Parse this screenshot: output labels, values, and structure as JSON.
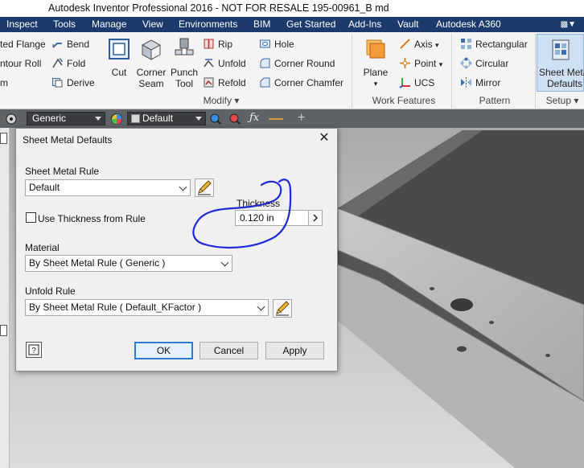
{
  "window": {
    "title": "Autodesk Inventor Professional 2016 - NOT FOR RESALE    195-00961_B md"
  },
  "menu": {
    "tabs": [
      "Inspect",
      "Tools",
      "Manage",
      "View",
      "Environments",
      "BIM",
      "Get Started",
      "Add-Ins",
      "Vault",
      "Autodesk A360"
    ]
  },
  "ribbon": {
    "left_items": [
      "ted Flange",
      "ntour Roll",
      "m"
    ],
    "bend_items": [
      "Bend",
      "Fold",
      "Derive"
    ],
    "big_buttons": {
      "cut": "Cut",
      "corner_seam": [
        "Corner",
        "Seam"
      ],
      "punch_tool": [
        "Punch",
        "Tool"
      ],
      "plane": "Plane",
      "sheet_metal_defaults": [
        "Sheet Metal",
        "Defaults"
      ]
    },
    "modify_items": [
      "Rip",
      "Unfold",
      "Refold"
    ],
    "corner_items": [
      "Hole",
      "Corner Round",
      "Corner Chamfer"
    ],
    "work_items": [
      "Axis",
      "Point",
      "UCS"
    ],
    "pattern_items": [
      "Rectangular",
      "Circular",
      "Mirror"
    ],
    "panels": {
      "modify": "Modify",
      "work_features": "Work Features",
      "pattern": "Pattern",
      "setup": "Setup"
    }
  },
  "property_toolbar": {
    "material": "Generic",
    "appearance": "Default"
  },
  "dialog": {
    "title": "Sheet Metal Defaults",
    "sheet_metal_rule_label": "Sheet Metal Rule",
    "sheet_metal_rule_value": "Default",
    "use_thickness_label": "Use Thickness from Rule",
    "thickness_label": "Thickness",
    "thickness_value": "0.120 in",
    "material_label": "Material",
    "material_value": "By Sheet Metal Rule ( Generic )",
    "unfold_rule_label": "Unfold Rule",
    "unfold_rule_value": "By Sheet Metal Rule ( Default_KFactor )",
    "ok": "OK",
    "cancel": "Cancel",
    "apply": "Apply"
  },
  "colors": {
    "menubar": "#1b3b6c",
    "annotation_ink": "#1a2bd8",
    "default_button_border": "#2e7bd2"
  }
}
